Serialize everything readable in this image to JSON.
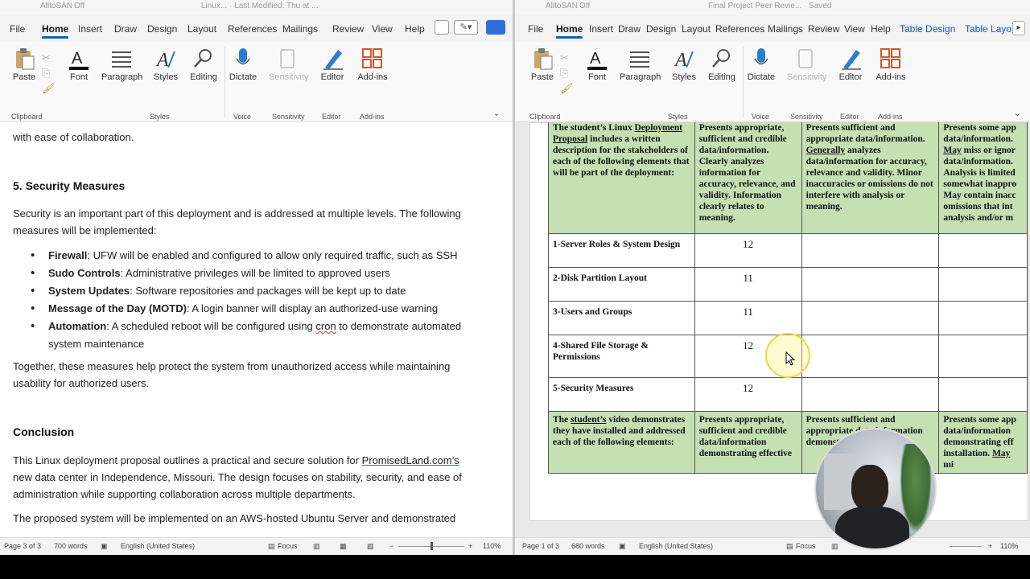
{
  "left": {
    "topbar": {
      "account": "AlltoSAN",
      "toggle": "Off",
      "title": "Linux... · Last Modified: Thu at ..."
    },
    "tabs": [
      "File",
      "Home",
      "Insert",
      "Draw",
      "Design",
      "Layout",
      "References",
      "Mailings",
      "Review",
      "View",
      "Help"
    ],
    "ribbon": {
      "paste": "Paste",
      "font": "Font",
      "paragraph": "Paragraph",
      "styles": "Styles",
      "editing": "Editing",
      "dictate": "Dictate",
      "sensitivity": "Sensitivity",
      "editor": "Editor",
      "addins": "Add-ins",
      "groups": {
        "clipboard": "Clipboard",
        "styles": "Styles",
        "voice": "Voice",
        "sensitivity": "Sensitivity",
        "editor": "Editor",
        "addins": "Add-ins"
      }
    },
    "doc": {
      "top_line": "with ease of collaboration.",
      "section_heading": "5.  Security Measures",
      "intro": "Security is an important part of this deployment and is addressed at multiple levels. The following measures will be implemented:",
      "bullets": [
        {
          "bold": "Firewall",
          "text": ": UFW will be enabled and configured to allow only required traffic, such as SSH"
        },
        {
          "bold": "Sudo Controls",
          "text": ": Administrative privileges will be limited to approved users"
        },
        {
          "bold": "System Updates",
          "text": ": Software repositories and packages will be kept up to date"
        },
        {
          "bold": "Message of the Day (MOTD)",
          "text": ": A login banner will display an authorized-use warning"
        },
        {
          "bold": "Automation",
          "text_a": ": A scheduled reboot will be configured using ",
          "cron": "cron",
          "text_b": " to demonstrate automated system maintenance"
        }
      ],
      "together": "Together, these measures help protect the system from unauthorized access while maintaining usability for authorized users.",
      "conclusion_heading": "Conclusion",
      "conclusion_a": "This Linux deployment proposal outlines a practical and secure solution for ",
      "conclusion_link": "PromisedLand.com’s",
      "conclusion_b": " new data center in Independence, Missouri. The design focuses on stability, security, and ease of administration while supporting collaboration across multiple departments.",
      "last_line": "The proposed system will be implemented on an AWS-hosted Ubuntu Server and demonstrated"
    },
    "status": {
      "page": "Page 3 of 3",
      "words": "700 words",
      "language": "English (United States)",
      "focus": "Focus",
      "zoom": "110%"
    }
  },
  "right": {
    "topbar": {
      "account": "AlltoSAN",
      "toggle": "Off",
      "title": "Final Project Peer Revie... · Saved"
    },
    "tabs": [
      "File",
      "Home",
      "Insert",
      "Draw",
      "Design",
      "Layout",
      "References",
      "Mailings",
      "Review",
      "View",
      "Help",
      "Table Design",
      "Table Layo"
    ],
    "ribbon": {
      "paste": "Paste",
      "font": "Font",
      "paragraph": "Paragraph",
      "styles": "Styles",
      "editing": "Editing",
      "dictate": "Dictate",
      "sensitivity": "Sensitivity",
      "editor": "Editor",
      "addins": "Add-ins",
      "groups": {
        "clipboard": "Clipboard",
        "styles": "Styles",
        "voice": "Voice",
        "sensitivity": "Sensitivity",
        "editor": "Editor",
        "addins": "Add-ins"
      }
    },
    "table": {
      "header": {
        "c1_a": "The student’s Linux ",
        "c1_u": "Deployment Proposal",
        "c1_b": " includes a written description for the stakeholders of each of the following elements that will be part of the deployment:",
        "c2": "Presents appropriate, sufficient and credible data/information. Clearly analyzes information for accuracy, relevance, and validity. Information clearly relates to meaning.",
        "c3_a": "Presents sufficient and appropriate data/information. ",
        "c3_u": "Generally",
        "c3_b": " analyzes data/information for accuracy, relevance and validity. Minor inaccuracies or omissions do not interfere with analysis or meaning.",
        "c4_a": "Presents some app data/information. ",
        "c4_u": "May",
        "c4_b": " miss or ignor data/information. Analysis is limited somewhat inappro May contain inacc omissions that int analysis and/or m"
      },
      "rows": [
        {
          "label": "1-Server Roles & System Design",
          "score": "12"
        },
        {
          "label": "2-Disk Partition Layout",
          "score": "11"
        },
        {
          "label": "3-Users and Groups",
          "score": "11"
        },
        {
          "label": "4-Shared File Storage & Permissions",
          "score": "12"
        },
        {
          "label": "5-Security Measures",
          "score": "12"
        }
      ],
      "footer": {
        "c1_a": "The ",
        "c1_u": "student’s",
        "c1_b": " video demonstrates they have installed and addressed each of the following elements:",
        "c2": "Presents appropriate, sufficient and credible data/information demonstrating effective",
        "c3": "Presents sufficient and appropriate data/information demonstrating installation",
        "c4_a": "Presents some app data/information demonstrating eff installation. ",
        "c4_u": "May",
        "c4_b": " mi"
      }
    },
    "status": {
      "page": "Page 1 of 3",
      "words": "680 words",
      "language": "English (United States)",
      "focus": "Focus",
      "zoom": "110%"
    }
  }
}
